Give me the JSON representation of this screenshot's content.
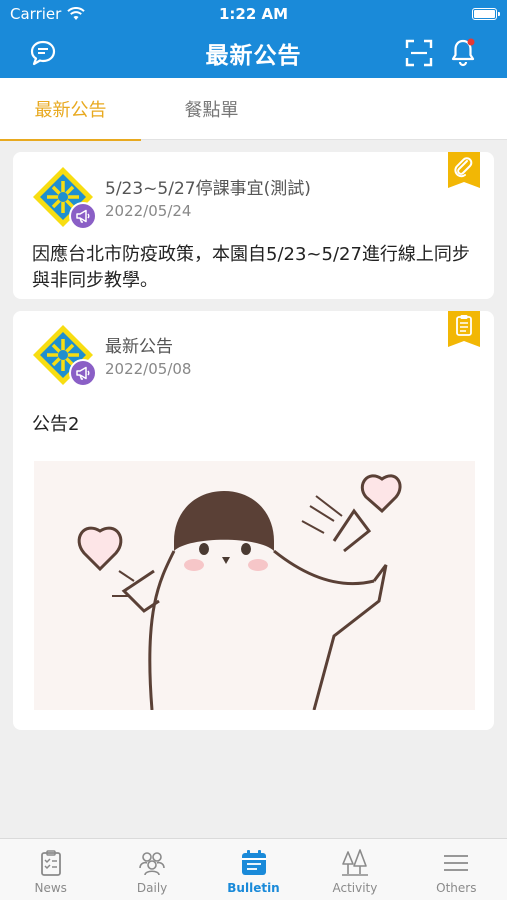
{
  "status": {
    "carrier": "Carrier",
    "time": "1:22 AM"
  },
  "nav": {
    "title": "最新公告"
  },
  "tabs": [
    {
      "label": "最新公告"
    },
    {
      "label": "餐點單"
    }
  ],
  "posts": [
    {
      "title": "5/23~5/27停課事宜(測試)",
      "date": "2022/05/24",
      "body": "因應台北市防疫政策，本園自5/23~5/27進行線上同步與非同步教學。",
      "badge_icon": "paperclip-icon"
    },
    {
      "title": "最新公告",
      "date": "2022/05/08",
      "body": "公告2",
      "badge_icon": "clipboard-icon"
    }
  ],
  "tabbar": [
    {
      "label": "News",
      "icon": "clipboard-list-icon"
    },
    {
      "label": "Daily",
      "icon": "people-icon"
    },
    {
      "label": "Bulletin",
      "icon": "calendar-icon"
    },
    {
      "label": "Activity",
      "icon": "trees-icon"
    },
    {
      "label": "Others",
      "icon": "menu-icon"
    }
  ],
  "colors": {
    "primary": "#1a8ad9",
    "accent": "#e8a91f",
    "badge": "#f2b705",
    "megaphone": "#8a5fc6"
  }
}
